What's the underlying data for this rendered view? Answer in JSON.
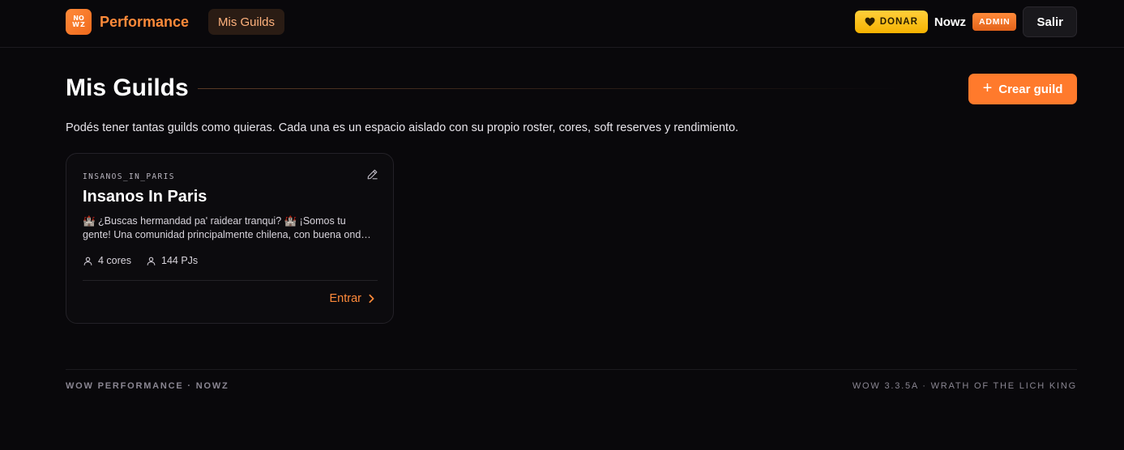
{
  "header": {
    "logo_text": [
      "NO",
      "W",
      "Z"
    ],
    "brand": "Performance",
    "nav_active": "Mis Guilds",
    "donate_label": "DONAR",
    "username": "Nowz",
    "role_badge": "ADMIN",
    "logout_label": "Salir"
  },
  "main": {
    "title": "Mis Guilds",
    "create_label": "Crear guild",
    "subtitle": "Podés tener tantas guilds como quieras. Cada una es un espacio aislado con su propio roster, cores, soft reserves y rendimiento."
  },
  "guilds": [
    {
      "slug": "INSANOS_IN_PARIS",
      "name": "Insanos In Paris",
      "description_line1": "🏰 ¿Buscas hermandad pa' raidear tranqui? 🏰 ¡Somos tu",
      "description_line2": "gente! Una comunidad principalmente chilena, con buena ond…",
      "cores": "4 cores",
      "characters": "144 PJs",
      "enter_label": "Entrar"
    }
  ],
  "footer": {
    "left": "WOW PERFORMANCE · NOWZ",
    "right": "WOW 3.3.5A · WRATH OF THE LICH KING"
  },
  "colors": {
    "accent": "#ff7a2c",
    "background": "#09080b",
    "donate": "#f5b200"
  }
}
